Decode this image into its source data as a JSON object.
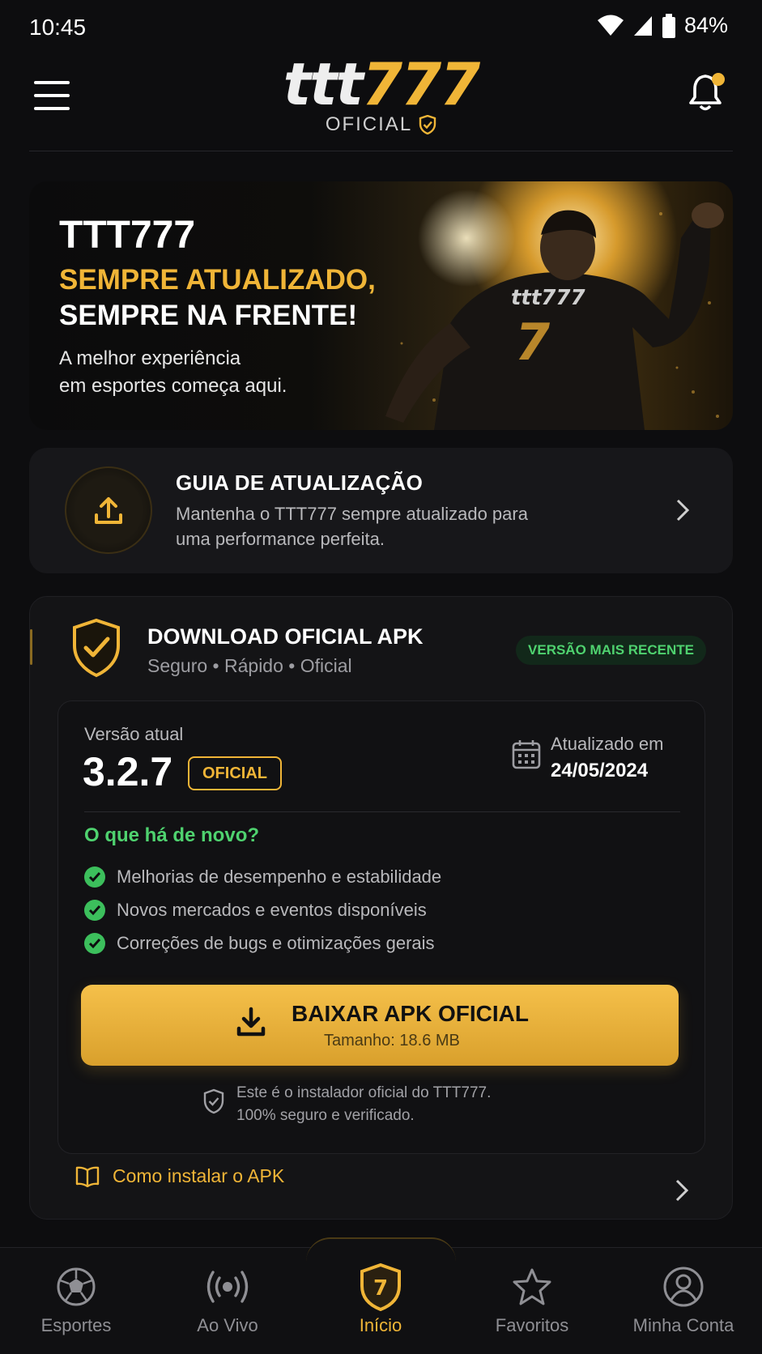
{
  "status_bar": {
    "time": "10:45",
    "battery": "84%"
  },
  "header": {
    "logo_ttt": "ttt",
    "logo_777": "777",
    "logo_sub": "OFICIAL",
    "notification_dot": true
  },
  "hero": {
    "title": "TTT777",
    "subtitle_1": "SEMPRE ATUALIZADO,",
    "subtitle_2": "SEMPRE NA FRENTE!",
    "desc_1": "A melhor experiência",
    "desc_2": "em esportes começa aqui.",
    "jersey_brand": "ttt777",
    "jersey_number": "7"
  },
  "guide": {
    "title": "GUIA DE ATUALIZAÇÃO",
    "desc": "Mantenha o TTT777 sempre atualizado para uma performance perfeita."
  },
  "download": {
    "title": "DOWNLOAD OFICIAL APK",
    "subtitle": "Seguro • Rápido • Oficial",
    "badge": "VERSÃO MAIS RECENTE",
    "version_label": "Versão atual",
    "version": "3.2.7",
    "version_tag": "OFICIAL",
    "updated_label": "Atualizado em",
    "updated_date": "24/05/2024",
    "news_title": "O que há de novo?",
    "news": [
      "Melhorias de desempenho e estabilidade",
      "Novos mercados e eventos disponíveis",
      "Correções de bugs e otimizações gerais"
    ],
    "button_label": "BAIXAR APK OFICIAL",
    "button_size": "Tamanho: 18.6 MB",
    "safe_1": "Este é o instalador oficial do TTT777.",
    "safe_2": "100% seguro e verificado.",
    "howto": "Como instalar o APK"
  },
  "nav": [
    {
      "label": "Esportes",
      "icon": "soccer-ball-icon"
    },
    {
      "label": "Ao Vivo",
      "icon": "live-broadcast-icon"
    },
    {
      "label": "Início",
      "icon": "home-shield-icon",
      "badge": "7"
    },
    {
      "label": "Favoritos",
      "icon": "star-icon"
    },
    {
      "label": "Minha Conta",
      "icon": "account-icon"
    }
  ],
  "colors": {
    "accent": "#f0b537",
    "success": "#4fd26f",
    "background": "#0d0d0f",
    "card": "#141416"
  }
}
